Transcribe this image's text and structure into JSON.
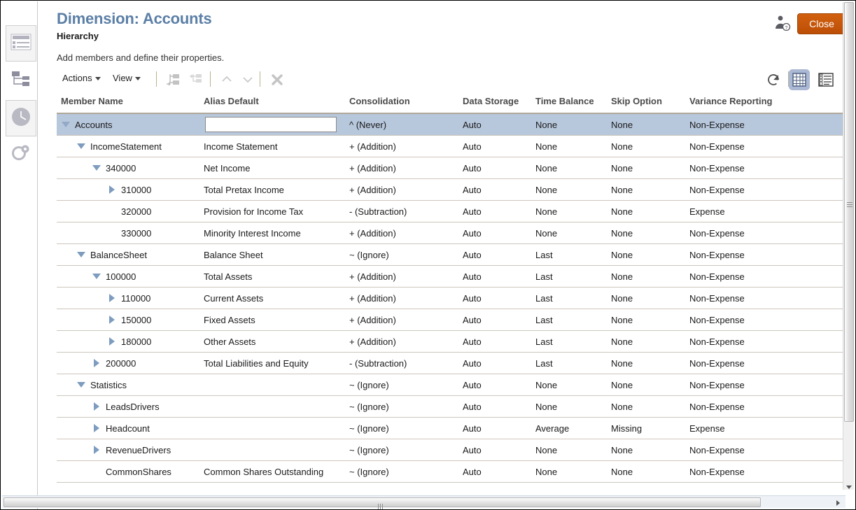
{
  "window": {
    "title": "Dimension: Accounts",
    "subtitle": "Hierarchy",
    "instruction": "Add members and define their properties.",
    "close_label": "Close",
    "accent_color": "#bc4e06",
    "title_color": "#5b7fa6",
    "selected_row_color": "#b7c7dc"
  },
  "sidebar": {
    "items": [
      {
        "icon": "list-panel-icon",
        "label": "Dimensions"
      },
      {
        "icon": "hierarchy-tree-icon",
        "label": "Hierarchy"
      },
      {
        "icon": "clock-icon",
        "label": "Time Period"
      },
      {
        "icon": "key-icon",
        "label": "Security"
      }
    ]
  },
  "toolbar": {
    "actions_label": "Actions",
    "view_label": "View",
    "icons": [
      {
        "name": "add-sibling-icon",
        "enabled": false
      },
      {
        "name": "add-child-icon",
        "enabled": false
      },
      {
        "name": "move-up-icon",
        "enabled": false
      },
      {
        "name": "move-down-icon",
        "enabled": false
      },
      {
        "name": "delete-icon",
        "enabled": false
      }
    ],
    "right_icons": [
      {
        "name": "refresh-icon",
        "enabled": true
      },
      {
        "name": "grid-view-icon",
        "enabled": true,
        "selected": true
      },
      {
        "name": "detail-view-icon",
        "enabled": true,
        "selected": false
      }
    ]
  },
  "table": {
    "columns": [
      "Member Name",
      "Alias Default",
      "Consolidation",
      "Data Storage",
      "Time Balance",
      "Skip Option",
      "Variance Reporting"
    ],
    "rows": [
      {
        "member": "Accounts",
        "indent": 0,
        "twisty": "expanded",
        "selected": true,
        "alias_is_input": true,
        "alias": "",
        "alias_placeholder": "",
        "consolidation": "^ (Never)",
        "storage": "Auto",
        "time_balance": "None",
        "skip": "None",
        "variance": "Non-Expense"
      },
      {
        "member": "IncomeStatement",
        "indent": 1,
        "twisty": "expanded",
        "selected": false,
        "alias": "Income Statement",
        "consolidation": "+ (Addition)",
        "storage": "Auto",
        "time_balance": "None",
        "skip": "None",
        "variance": "Non-Expense"
      },
      {
        "member": "340000",
        "indent": 2,
        "twisty": "expanded",
        "selected": false,
        "alias": "Net Income",
        "consolidation": "+ (Addition)",
        "storage": "Auto",
        "time_balance": "None",
        "skip": "None",
        "variance": "Non-Expense"
      },
      {
        "member": "310000",
        "indent": 3,
        "twisty": "collapsed",
        "selected": false,
        "alias": "Total Pretax Income",
        "consolidation": "+ (Addition)",
        "storage": "Auto",
        "time_balance": "None",
        "skip": "None",
        "variance": "Non-Expense"
      },
      {
        "member": "320000",
        "indent": 3,
        "twisty": "none",
        "selected": false,
        "alias": "Provision for Income Tax",
        "consolidation": "- (Subtraction)",
        "storage": "Auto",
        "time_balance": "None",
        "skip": "None",
        "variance": "Expense"
      },
      {
        "member": "330000",
        "indent": 3,
        "twisty": "none",
        "selected": false,
        "alias": "Minority Interest Income",
        "consolidation": "+ (Addition)",
        "storage": "Auto",
        "time_balance": "None",
        "skip": "None",
        "variance": "Non-Expense"
      },
      {
        "member": "BalanceSheet",
        "indent": 1,
        "twisty": "expanded",
        "selected": false,
        "alias": "Balance Sheet",
        "consolidation": "~ (Ignore)",
        "storage": "Auto",
        "time_balance": "Last",
        "skip": "None",
        "variance": "Non-Expense"
      },
      {
        "member": "100000",
        "indent": 2,
        "twisty": "expanded",
        "selected": false,
        "alias": "Total Assets",
        "consolidation": "+ (Addition)",
        "storage": "Auto",
        "time_balance": "Last",
        "skip": "None",
        "variance": "Non-Expense"
      },
      {
        "member": "110000",
        "indent": 3,
        "twisty": "collapsed",
        "selected": false,
        "alias": "Current Assets",
        "consolidation": "+ (Addition)",
        "storage": "Auto",
        "time_balance": "Last",
        "skip": "None",
        "variance": "Non-Expense"
      },
      {
        "member": "150000",
        "indent": 3,
        "twisty": "collapsed",
        "selected": false,
        "alias": "Fixed Assets",
        "consolidation": "+ (Addition)",
        "storage": "Auto",
        "time_balance": "Last",
        "skip": "None",
        "variance": "Non-Expense"
      },
      {
        "member": "180000",
        "indent": 3,
        "twisty": "collapsed",
        "selected": false,
        "alias": "Other Assets",
        "consolidation": "+ (Addition)",
        "storage": "Auto",
        "time_balance": "Last",
        "skip": "None",
        "variance": "Non-Expense"
      },
      {
        "member": "200000",
        "indent": 2,
        "twisty": "collapsed",
        "selected": false,
        "alias": "Total Liabilities and Equity",
        "consolidation": "- (Subtraction)",
        "storage": "Auto",
        "time_balance": "Last",
        "skip": "None",
        "variance": "Non-Expense"
      },
      {
        "member": "Statistics",
        "indent": 1,
        "twisty": "expanded",
        "selected": false,
        "alias": "",
        "consolidation": "~ (Ignore)",
        "storage": "Auto",
        "time_balance": "None",
        "skip": "None",
        "variance": "Non-Expense"
      },
      {
        "member": "LeadsDrivers",
        "indent": 2,
        "twisty": "collapsed",
        "selected": false,
        "alias": "",
        "consolidation": "~ (Ignore)",
        "storage": "Auto",
        "time_balance": "None",
        "skip": "None",
        "variance": "Non-Expense"
      },
      {
        "member": "Headcount",
        "indent": 2,
        "twisty": "collapsed",
        "selected": false,
        "alias": "",
        "consolidation": "~ (Ignore)",
        "storage": "Auto",
        "time_balance": "Average",
        "skip": "Missing",
        "variance": "Expense"
      },
      {
        "member": "RevenueDrivers",
        "indent": 2,
        "twisty": "collapsed",
        "selected": false,
        "alias": "",
        "consolidation": "~ (Ignore)",
        "storage": "Auto",
        "time_balance": "None",
        "skip": "None",
        "variance": "Non-Expense"
      },
      {
        "member": "CommonShares",
        "indent": 2,
        "twisty": "none",
        "selected": false,
        "alias": "Common Shares Outstanding",
        "consolidation": "~ (Ignore)",
        "storage": "Auto",
        "time_balance": "None",
        "skip": "None",
        "variance": "Non-Expense"
      }
    ]
  }
}
